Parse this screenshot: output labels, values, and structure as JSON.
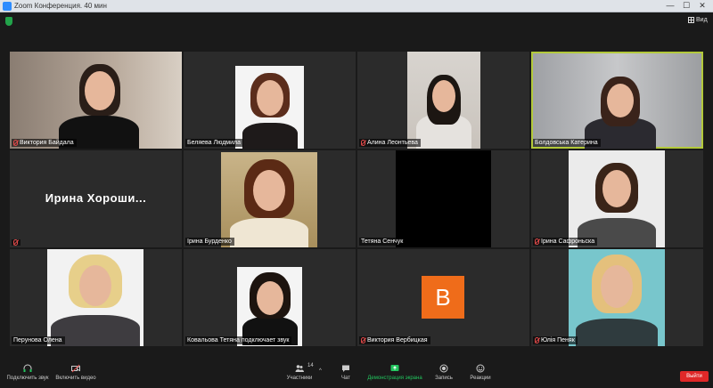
{
  "window": {
    "title": "Zoom Конференция. 40 мин",
    "min": "—",
    "max": "☐",
    "close": "✕"
  },
  "topbar": {
    "view_label": "Вид"
  },
  "participants": [
    {
      "name": "Виктория Байдала",
      "muted": true
    },
    {
      "name": "Беляева Людмила",
      "muted": false
    },
    {
      "name": "Алина Леонтьева",
      "muted": true
    },
    {
      "name": "Болдовська Катерина",
      "muted": false,
      "active": true
    },
    {
      "name": "Ирина Хороши...",
      "muted": true,
      "no_video": true
    },
    {
      "name": "Ірина Бурденко",
      "muted": false
    },
    {
      "name": "Тетяна Сенчук",
      "muted": false
    },
    {
      "name": "Ірина Сафроньска",
      "muted": true
    },
    {
      "name": "Перунова Олена",
      "muted": false
    },
    {
      "name": "Ковальова Тетяна подключает звук",
      "muted": false
    },
    {
      "name": "Виктория Вербицкая",
      "muted": true,
      "avatar_letter": "B"
    },
    {
      "name": "Юлія Пеняк",
      "muted": true
    }
  ],
  "toolbar": {
    "audio": "Подключить звук",
    "video": "Включить видео",
    "participants": "Участники",
    "participants_count": "14",
    "chat": "Чат",
    "share": "Демонстрация экрана",
    "record": "Запись",
    "reactions": "Реакции",
    "end": "Выйти"
  },
  "colors": {
    "active_border": "#b3c93a",
    "end_red": "#e02828",
    "avatar_orange": "#ef6c1a",
    "share_green": "#22c55e"
  }
}
